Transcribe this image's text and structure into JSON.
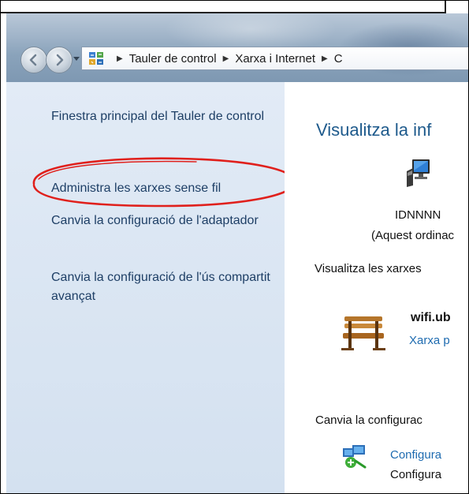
{
  "navigation": {
    "back_icon": "back-arrow-icon",
    "forward_icon": "forward-arrow-icon",
    "recent_icon": "chevron-down-icon",
    "address_icon": "control-panel-icon",
    "breadcrumbs": [
      "Tauler de control",
      "Xarxa i Internet",
      "C"
    ],
    "separator": "▶"
  },
  "sidebar": {
    "items": [
      {
        "label": "Finestra principal del Tauler de control"
      },
      {
        "label": "Administra les xarxes sense fil"
      },
      {
        "label": "Canvia la configuració de l'adaptador"
      },
      {
        "label": "Canvia la configuració de l'ús compartit avançat"
      }
    ],
    "highlight_color": "#e0201c"
  },
  "main": {
    "title": "Visualitza la inf",
    "computer": {
      "icon": "computer-icon",
      "name": "IDNNNN",
      "subtitle": "(Aquest ordinac"
    },
    "networks_heading": "Visualitza les xarxes",
    "network": {
      "icon": "bench-icon",
      "name": "wifi.ub",
      "type": "Xarxa p"
    },
    "settings_heading": "Canvia la configurac",
    "setup": {
      "icon": "network-setup-icon",
      "link": "Configura",
      "description": "Configura"
    }
  },
  "colors": {
    "link": "#1e3f66",
    "title": "#1e5a8c",
    "action_link": "#1e6bb0",
    "sidebar_bg": "#dbe6f3"
  }
}
